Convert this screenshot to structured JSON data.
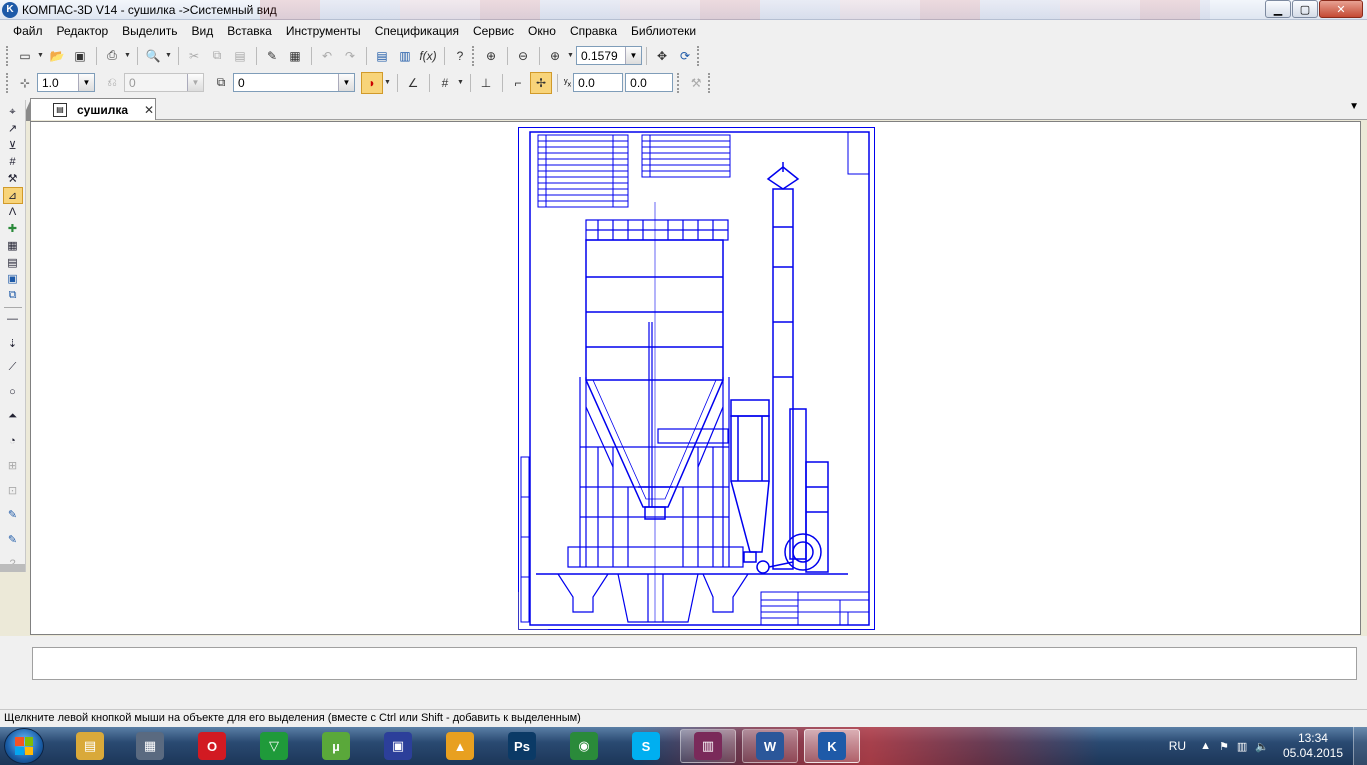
{
  "window": {
    "title": "КОМПАС-3D V14 - сушилка ->Системный вид",
    "app_icon": "kompas-logo-icon",
    "controls": {
      "minimize": "▁",
      "maximize": "▢",
      "close": "✕"
    }
  },
  "menu": [
    "Файл",
    "Редактор",
    "Выделить",
    "Вид",
    "Вставка",
    "Инструменты",
    "Спецификация",
    "Сервис",
    "Окно",
    "Справка",
    "Библиотеки"
  ],
  "toolbar_standard": {
    "zoom_value": "0.1579"
  },
  "toolbar_current_state": {
    "step_value": "1.0",
    "view_value": "0",
    "layer_value": "0",
    "coord_x": "0.0",
    "coord_y": "0.0"
  },
  "document_tab": {
    "label": "сушилка",
    "close": "✕"
  },
  "status_text": "Щелкните левой кнопкой мыши на объекте для его выделения (вместе с Ctrl или Shift - добавить к выделенным)",
  "taskbar": {
    "items": [
      {
        "name": "explorer",
        "glyph": "▤",
        "color": "#d9a93a"
      },
      {
        "name": "calculator",
        "glyph": "▦",
        "color": "#5a6a80"
      },
      {
        "name": "opera",
        "glyph": "O",
        "color": "#d21a22"
      },
      {
        "name": "corel",
        "glyph": "▽",
        "color": "#1f9a3a"
      },
      {
        "name": "utorrent",
        "glyph": "µ",
        "color": "#5aa83a"
      },
      {
        "name": "floppy",
        "glyph": "▣",
        "color": "#2c3f9a"
      },
      {
        "name": "archicad",
        "glyph": "▲",
        "color": "#e8a020"
      },
      {
        "name": "photoshop",
        "glyph": "Ps",
        "color": "#0b3a66"
      },
      {
        "name": "chrome",
        "glyph": "◉",
        "color": "#2a8a3a"
      },
      {
        "name": "skype",
        "glyph": "S",
        "color": "#00aff0"
      },
      {
        "name": "winrar",
        "glyph": "▥",
        "color": "#7a2a5a"
      },
      {
        "name": "word",
        "glyph": "W",
        "color": "#2b579a"
      },
      {
        "name": "kompas",
        "glyph": "K",
        "color": "#1e5aa8"
      }
    ],
    "lang": "RU",
    "time": "13:34",
    "date": "05.04.2015"
  },
  "colors": {
    "drawing_line": "#0000ee",
    "active_tool": "#f8d47a"
  }
}
